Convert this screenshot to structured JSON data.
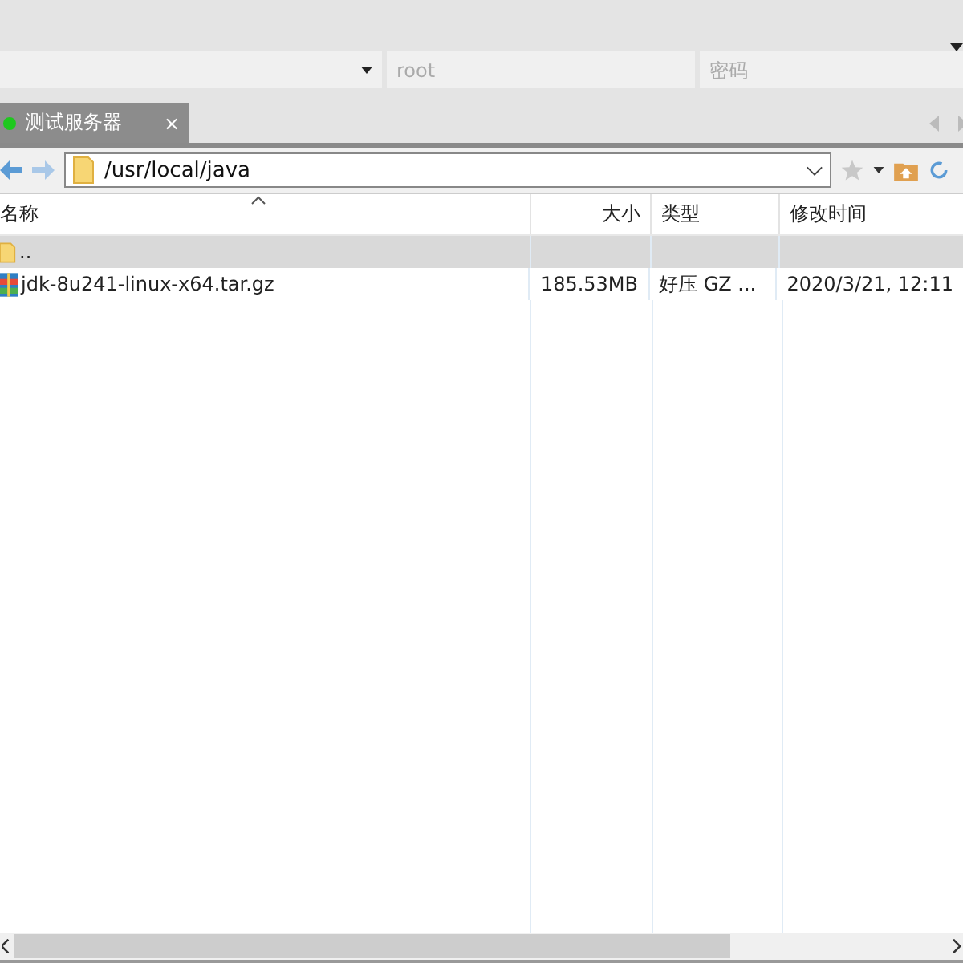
{
  "connection": {
    "username": "root",
    "password_placeholder": "密码"
  },
  "tabs": [
    {
      "label": "测试服务器",
      "selected": true,
      "connected": true,
      "close": "×"
    }
  ],
  "address": {
    "path": "/usr/local/java"
  },
  "table": {
    "columns": [
      "名称",
      "大小",
      "类型",
      "修改时间"
    ],
    "rows": [
      {
        "kind": "folder",
        "name": "..",
        "size": "",
        "type": "",
        "modified": "",
        "selected": true
      },
      {
        "kind": "archive",
        "name": "jdk-8u241-linux-x64.tar.gz",
        "size": "185.53MB",
        "type": "好压 GZ ...",
        "modified": "2020/3/21, 12:11",
        "selected": false
      }
    ]
  }
}
